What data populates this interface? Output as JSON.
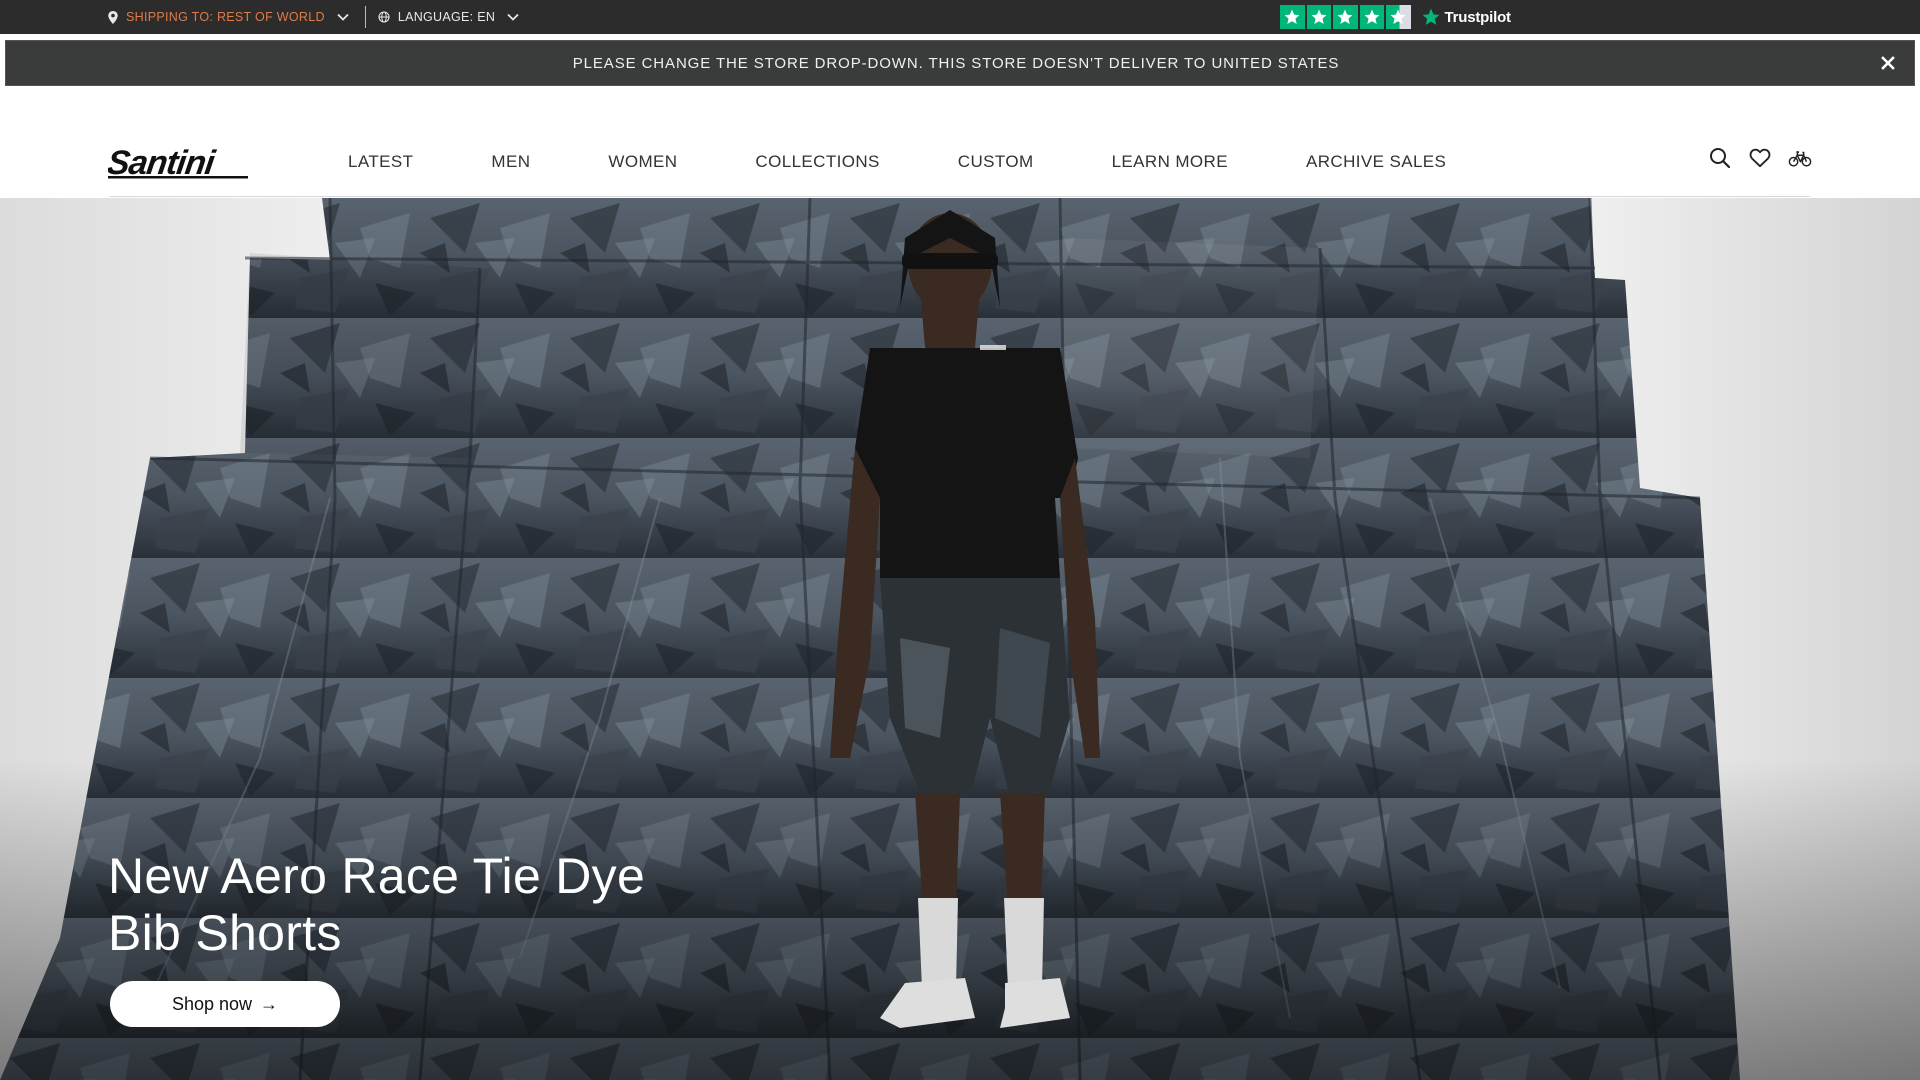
{
  "topbar": {
    "shipping_label": "SHIPPING TO: REST OF WORLD",
    "language_label": "LANGUAGE: EN",
    "trustpilot_label": "Trustpilot",
    "trustpilot_stars": 4.5,
    "colors": {
      "background": "#2b2c2b",
      "shipping": "#e07a4a",
      "trustpilot_green": "#00b67a"
    }
  },
  "notice": {
    "text": "PLEASE CHANGE THE STORE DROP-DOWN. THIS STORE DOESN'T DELIVER TO UNITED STATES",
    "close_icon": "close-icon"
  },
  "header": {
    "logo_text": "Santini",
    "nav": [
      {
        "label": "LATEST"
      },
      {
        "label": "MEN"
      },
      {
        "label": "WOMEN"
      },
      {
        "label": "COLLECTIONS"
      },
      {
        "label": "CUSTOM"
      },
      {
        "label": "LEARN MORE"
      },
      {
        "label": "ARCHIVE SALES"
      }
    ],
    "icons": [
      "search-icon",
      "heart-icon",
      "bike-icon"
    ]
  },
  "hero": {
    "title_line1": "New Aero Race Tie Dye",
    "title_line2": "Bib Shorts",
    "cta_label": "Shop now",
    "cta_arrow": "→"
  }
}
